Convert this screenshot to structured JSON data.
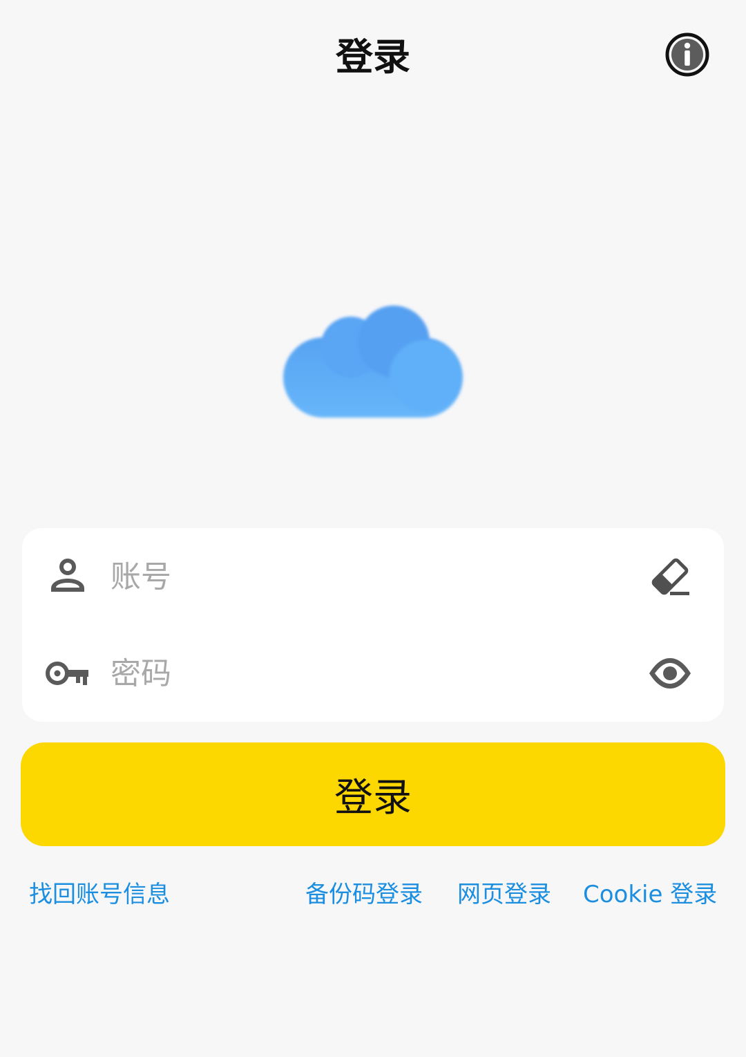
{
  "header": {
    "title": "登录"
  },
  "icons": {
    "info": "info-icon",
    "logo": "cloud-logo-icon",
    "account": "user-icon",
    "password": "key-icon",
    "clear": "eraser-icon",
    "visibility": "eye-icon"
  },
  "form": {
    "account_placeholder": "账号",
    "account_value": "",
    "password_placeholder": "密码",
    "password_value": ""
  },
  "login_button_label": "登录",
  "links": {
    "recover": "找回账号信息",
    "backup_code": "备份码登录",
    "web": "网页登录",
    "cookie": "Cookie 登录"
  },
  "colors": {
    "background": "#f7f7f8",
    "accent": "#fdd700",
    "link": "#1b8ee0",
    "cloud": "#5aa8f5"
  }
}
